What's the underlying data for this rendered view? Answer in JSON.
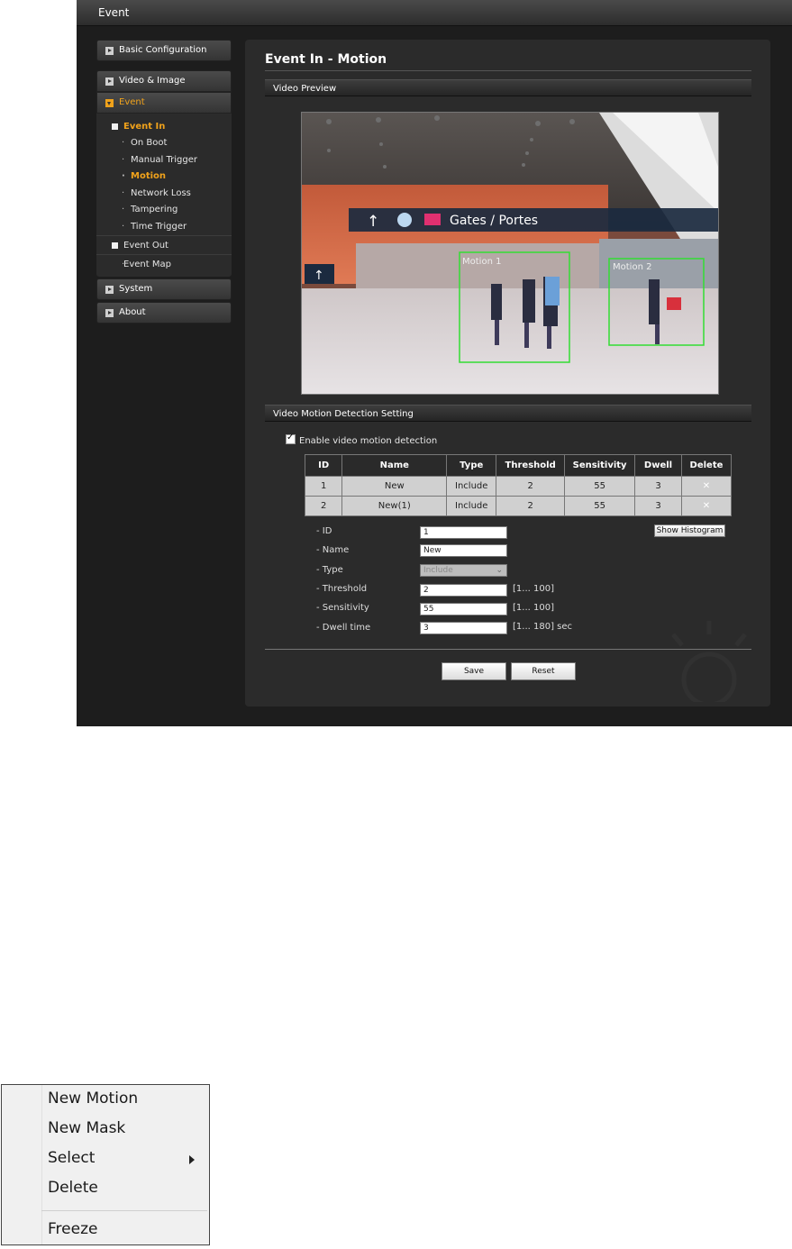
{
  "window": {
    "title": "Event"
  },
  "sidebar": {
    "basic_config": "Basic Configuration",
    "video_image": "Video & Image",
    "event": "Event",
    "event_in": "Event In",
    "event_in_items": [
      "On Boot",
      "Manual Trigger",
      "Motion",
      "Network Loss",
      "Tampering",
      "Time Trigger"
    ],
    "event_out": "Event Out",
    "event_map": "Event Map",
    "system": "System",
    "about": "About"
  },
  "main": {
    "title": "Event In - Motion",
    "video_preview": "Video Preview",
    "setting_section": "Video Motion Detection Setting",
    "enable_label": "Enable video motion detection",
    "enable_checked": true
  },
  "preview": {
    "sign_text": "Gates / Portes",
    "zones": [
      "Motion 1",
      "Motion 2"
    ]
  },
  "table": {
    "headers": [
      "ID",
      "Name",
      "Type",
      "Threshold",
      "Sensitivity",
      "Dwell",
      "Delete"
    ],
    "rows": [
      [
        "1",
        "New",
        "Include",
        "2",
        "55",
        "3",
        "✕"
      ],
      [
        "2",
        "New(1)",
        "Include",
        "2",
        "55",
        "3",
        "✕"
      ]
    ]
  },
  "form": {
    "id_label": "- ID",
    "id_value": "1",
    "name_label": "- Name",
    "name_value": "New",
    "type_label": "- Type",
    "type_value": "Include",
    "threshold_label": "- Threshold",
    "threshold_value": "2",
    "threshold_hint": "[1... 100]",
    "sensitivity_label": "- Sensitivity",
    "sensitivity_value": "55",
    "sensitivity_hint": "[1... 100]",
    "dwell_label": "- Dwell time",
    "dwell_value": "3",
    "dwell_hint": "[1... 180] sec",
    "histogram_button": "Show Histogram",
    "save_button": "Save",
    "reset_button": "Reset"
  },
  "context_menu": {
    "items": [
      "New Motion",
      "New Mask",
      "Select",
      "Delete",
      "Freeze"
    ]
  },
  "colors": {
    "accent": "#f0a21b",
    "zone": "#33dd33",
    "background": "#1d1d1d"
  }
}
